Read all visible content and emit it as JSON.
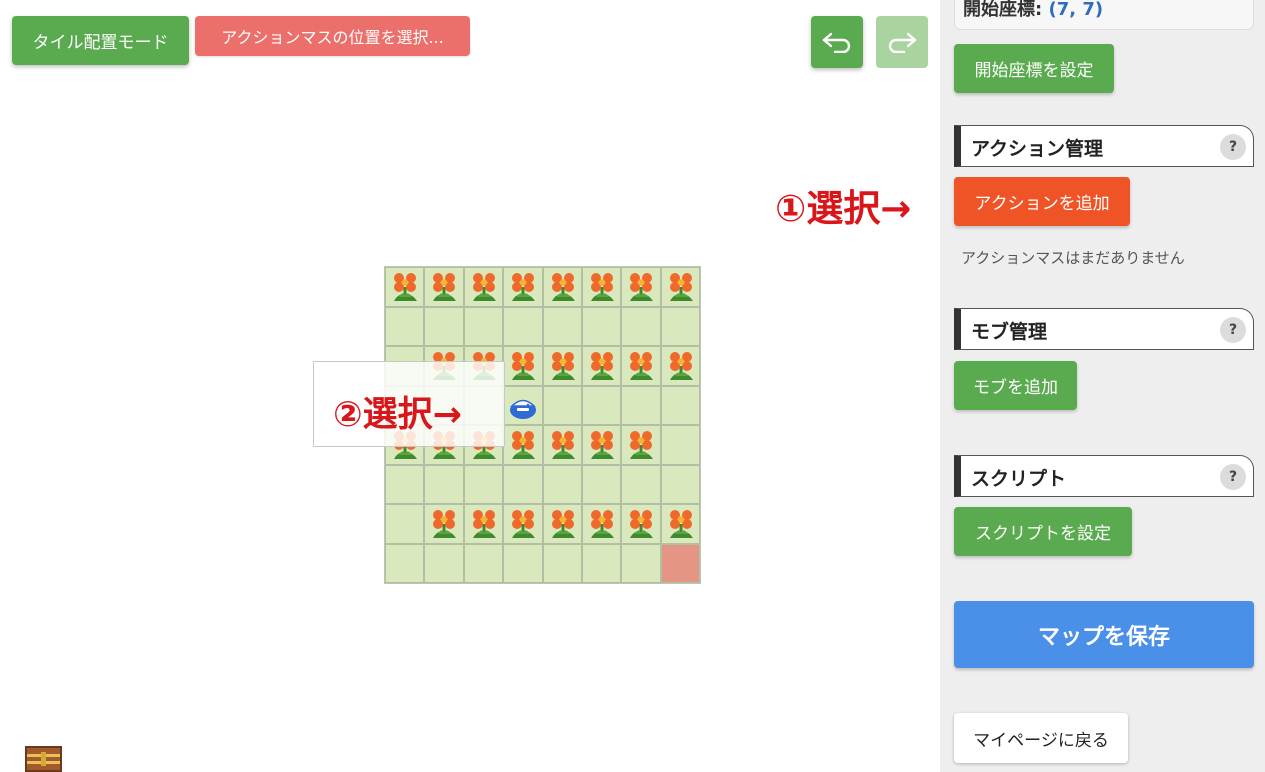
{
  "toolbar": {
    "tile_mode_label": "タイル配置モード",
    "action_select_label": "アクションマスの位置を選択...",
    "undo_icon": "undo-arrow-icon",
    "redo_icon": "redo-arrow-icon",
    "colors": {
      "green": "#5aaa4f",
      "red": "#eb6f6a",
      "disabled_green": "#a9d4a0"
    }
  },
  "map": {
    "rows": 8,
    "cols": 8,
    "tiles": [
      "FFFFFFFF",
      "........",
      ".FFFFFFF",
      "...M....",
      "FFFFFFF.",
      "........",
      ".FFFFFFF",
      ".......D"
    ],
    "legend": {
      "F": "flower-tile",
      ".": "grass-tile",
      "M": "mob",
      "D": "selected-destination-tile"
    },
    "colors": {
      "grass": "#d9e8bd",
      "destination": "#e49584"
    }
  },
  "annotations": {
    "step1": "①選択→",
    "step2": "②選択→"
  },
  "sidebar": {
    "start_coord_label": "開始座標:",
    "start_coord_value": "(7, 7)",
    "set_start_button": "開始座標を設定",
    "action_section_title": "アクション管理",
    "add_action_button": "アクションを追加",
    "no_action_text": "アクションマスはまだありません",
    "mob_section_title": "モブ管理",
    "add_mob_button": "モブを追加",
    "script_section_title": "スクリプト",
    "set_script_button": "スクリプトを設定",
    "help_label": "?",
    "save_map_button": "マップを保存",
    "back_button": "マイページに戻る",
    "colors": {
      "accent_orange": "#ef5427",
      "save_blue": "#4a90e8"
    }
  }
}
